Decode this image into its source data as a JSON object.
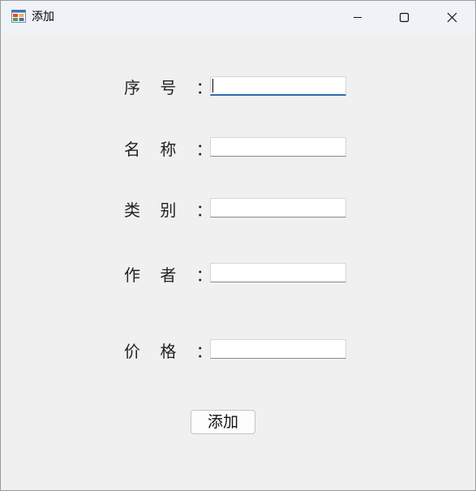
{
  "window": {
    "title": "添加",
    "icon": "app-window-icon",
    "controls": [
      "minimize-icon",
      "maximize-icon",
      "close-icon"
    ]
  },
  "form": {
    "fields": [
      {
        "label": "序 号 ：",
        "value": "",
        "placeholder": "",
        "focused": true
      },
      {
        "label": "名 称 ：",
        "value": "",
        "placeholder": ""
      },
      {
        "label": "类 别 ：",
        "value": "",
        "placeholder": ""
      },
      {
        "label": "作 者 ：",
        "value": "",
        "placeholder": ""
      },
      {
        "label": "价 格 ：",
        "value": "",
        "placeholder": ""
      }
    ],
    "submit_label": "添加"
  },
  "colors": {
    "focus_accent": "#2f6fae",
    "background": "#f0f0f0",
    "titlebar": "#eff3f8"
  }
}
